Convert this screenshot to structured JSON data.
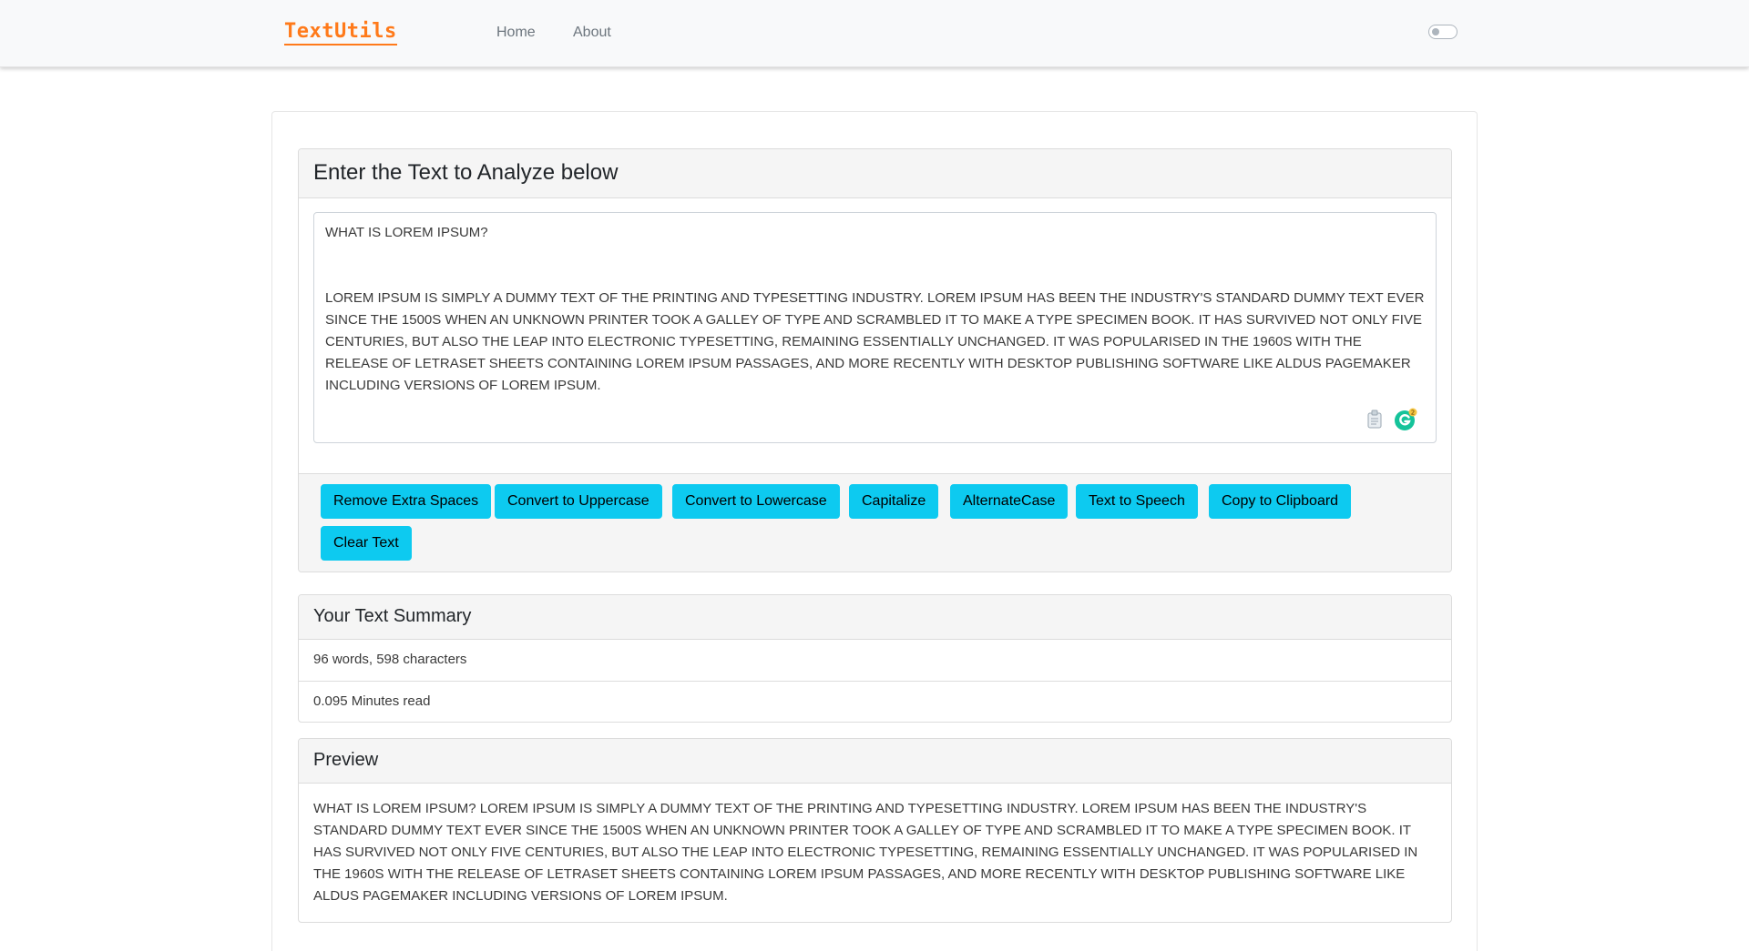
{
  "navbar": {
    "brand": "TextUtils",
    "links": [
      "Home",
      "About"
    ],
    "dark_mode_toggle": false
  },
  "analyze": {
    "heading": "Enter the Text to Analyze below",
    "text": "WHAT IS LOREM IPSUM?\n\n\nLOREM IPSUM IS SIMPLY A DUMMY TEXT OF THE PRINTING AND TYPESETTING INDUSTRY. LOREM IPSUM HAS BEEN THE INDUSTRY'S STANDARD DUMMY TEXT EVER SINCE THE 1500S WHEN AN UNKNOWN PRINTER TOOK A GALLEY OF TYPE AND SCRAMBLED IT TO MAKE A TYPE SPECIMEN BOOK. IT HAS SURVIVED NOT ONLY FIVE CENTURIES, BUT ALSO THE LEAP INTO ELECTRONIC TYPESETTING, REMAINING ESSENTIALLY UNCHANGED. IT WAS POPULARISED IN THE 1960S WITH THE RELEASE OF LETRASET SHEETS CONTAINING LOREM IPSUM PASSAGES, AND MORE RECENTLY WITH DESKTOP PUBLISHING SOFTWARE LIKE ALDUS PAGEMAKER INCLUDING VERSIONS OF LOREM IPSUM.",
    "grammarly_badge": "2",
    "buttons": [
      "Remove Extra Spaces",
      "Convert to Uppercase",
      "Convert to Lowercase",
      "Capitalize",
      "AlternateCase",
      "Text to Speech",
      "Copy to Clipboard",
      "Clear Text"
    ],
    "button_color": "#0dcaf0"
  },
  "summary": {
    "heading": "Your Text Summary",
    "counts": "96 words, 598 characters",
    "read_time": "0.095 Minutes read"
  },
  "preview": {
    "heading": "Preview",
    "text": "WHAT IS LOREM IPSUM? LOREM IPSUM IS SIMPLY A DUMMY TEXT OF THE PRINTING AND TYPESETTING INDUSTRY. LOREM IPSUM HAS BEEN THE INDUSTRY'S STANDARD DUMMY TEXT EVER SINCE THE 1500S WHEN AN UNKNOWN PRINTER TOOK A GALLEY OF TYPE AND SCRAMBLED IT TO MAKE A TYPE SPECIMEN BOOK. IT HAS SURVIVED NOT ONLY FIVE CENTURIES, BUT ALSO THE LEAP INTO ELECTRONIC TYPESETTING, REMAINING ESSENTIALLY UNCHANGED. IT WAS POPULARISED IN THE 1960S WITH THE RELEASE OF LETRASET SHEETS CONTAINING LOREM IPSUM PASSAGES, AND MORE RECENTLY WITH DESKTOP PUBLISHING SOFTWARE LIKE ALDUS PAGEMAKER INCLUDING VERSIONS OF LOREM IPSUM."
  },
  "colors": {
    "brand": "#ff7a1a",
    "navbar_bg": "#f8f9fa",
    "card_header_bg": "#f5f5f5"
  }
}
